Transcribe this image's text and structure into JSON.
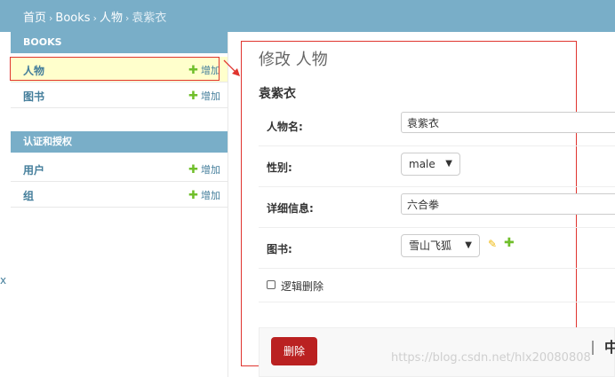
{
  "breadcrumbs": {
    "home": "首页",
    "app": "Books",
    "model": "人物",
    "current": "袁紫衣"
  },
  "sidebar": {
    "modules": [
      {
        "caption": "BOOKS",
        "rows": [
          {
            "name": "人物",
            "add": "增加",
            "highlighted": true
          },
          {
            "name": "图书",
            "add": "增加",
            "highlighted": false
          }
        ]
      },
      {
        "caption": "认证和授权",
        "rows": [
          {
            "name": "用户",
            "add": "增加",
            "highlighted": false
          },
          {
            "name": "组",
            "add": "增加",
            "highlighted": false
          }
        ]
      }
    ],
    "collapse_glyph": "x"
  },
  "main": {
    "title": "修改 人物",
    "object_name": "袁紫衣",
    "fields": {
      "name": {
        "label": "人物名:",
        "value": "袁紫衣"
      },
      "gender": {
        "label": "性别:",
        "value": "male"
      },
      "details": {
        "label": "详细信息:",
        "value": "六合拳"
      },
      "book": {
        "label": "图书:",
        "value": "雪山飞狐"
      }
    },
    "is_delete": {
      "label": "逻辑删除",
      "checked": false
    },
    "delete_button": "删除",
    "partial_button": "中"
  },
  "watermark": "https://blog.csdn.net/hlx20080808",
  "icons": {
    "add": "plus-icon",
    "edit": "pencil-icon",
    "dropdown": "chevron-down-icon"
  },
  "colors": {
    "header": "#79aec8",
    "link": "#447e9b",
    "add_green": "#70bf2b",
    "delete_red": "#ba2121",
    "annotation_red": "#e0342e",
    "highlight": "#ffffcc"
  }
}
